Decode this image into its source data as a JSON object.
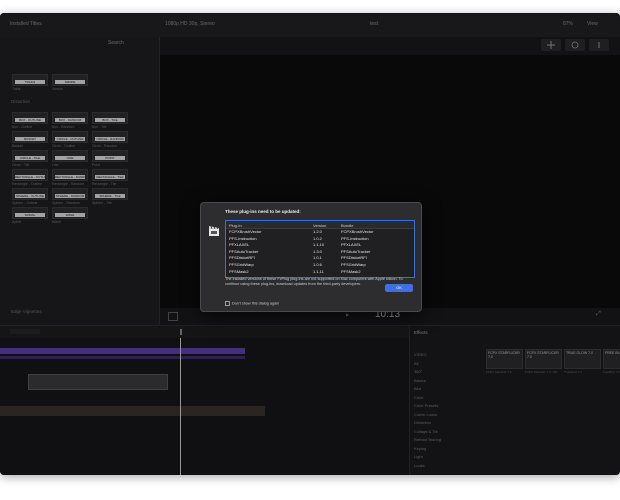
{
  "topbar": {
    "browser_title": "Installed Titles",
    "viewer_title": "1080p HD 30p, Stereo",
    "project": "test",
    "zoom": "87%",
    "view_label": "View"
  },
  "browser": {
    "search_placeholder": "Search",
    "sections": [
      "Distortion",
      "Edge Vignettes"
    ],
    "tiles": [
      {
        "label": "TRAILS",
        "cap": "Trails"
      },
      {
        "label": "SMOKE",
        "cap": "Smoke"
      },
      {
        "label": "BOX - OUTLINE",
        "cap": "Box - Outline"
      },
      {
        "label": "BOX - RANDOM",
        "cap": "Box - Random"
      },
      {
        "label": "BOX - TILE",
        "cap": "Box - Tile"
      },
      {
        "label": "BASKET",
        "cap": "Basket"
      },
      {
        "label": "CIRCLE - OUTLINE",
        "cap": "Circle - Outline"
      },
      {
        "label": "CIRCLE - RANDOM",
        "cap": "Circle - Random"
      },
      {
        "label": "CIRCLE - TILE",
        "cap": "Circle - Tile"
      },
      {
        "label": "LINE",
        "cap": "Line"
      },
      {
        "label": "POINT",
        "cap": "Point"
      },
      {
        "label": "RECTANGLE - OUTLINE",
        "cap": "Rectangle - Outline"
      },
      {
        "label": "RECTANGLE - RANDOM",
        "cap": "Rectangle - Random"
      },
      {
        "label": "RECTANGLE - TILE",
        "cap": "Rectangle - Tile"
      },
      {
        "label": "SPHERE - OUTLINE",
        "cap": "Sphere - Outline"
      },
      {
        "label": "SPHERE - RANDOM",
        "cap": "Sphere - Random"
      },
      {
        "label": "SPHERE - TILE",
        "cap": "Sphere - Tile"
      },
      {
        "label": "SPIRAL",
        "cap": "Spiral"
      },
      {
        "label": "WAVE",
        "cap": "Wave"
      }
    ]
  },
  "viewer": {
    "timecode": "10:13"
  },
  "effects": {
    "title": "Effects",
    "categories": [
      "VIDEO",
      "All",
      "360°",
      "Basics",
      "Blur",
      "Color",
      "Color Presets",
      "Comic Looks",
      "Distortion",
      "Collage & Tilt",
      "Refract Tearing",
      "Keying",
      "Light",
      "Looks"
    ],
    "tiles": [
      "FCPX STARFLICKR 7.0",
      "FCPX STARFLICKR 7.0",
      "TRUE GLOW 7.0",
      "FREE BLUR 7.0"
    ],
    "tile_caps": [
      "FCPX Starflickr 7.0",
      "FCPX Starflickr 7.0 - Mix",
      "TrueGlow 7.0",
      "FreeBlur 7.0"
    ]
  },
  "dialog": {
    "title": "These plug-ins need to be updated:",
    "columns": [
      "Plug-In",
      "Version",
      "Bundle"
    ],
    "rows": [
      {
        "plugin": "FCPXBrushVector",
        "version": "1.2.0",
        "bundle": "FCPXBrushVector"
      },
      {
        "plugin": "PFS-Instruction",
        "version": "1.0.2",
        "bundle": "PFS-Instruction"
      },
      {
        "plugin": "PFXLAXEL",
        "version": "1.1.10",
        "bundle": "PFXLAXEL"
      },
      {
        "plugin": "PFSAutoTracker",
        "version": "1.3.0",
        "bundle": "PFSAutoTracker"
      },
      {
        "plugin": "PFSDistortRFI",
        "version": "1.0.1",
        "bundle": "PFSDistortRFI"
      },
      {
        "plugin": "PFSGridWarp",
        "version": "1.0.6",
        "bundle": "PFSGridWarp"
      },
      {
        "plugin": "PFSMask2",
        "version": "1.1.11",
        "bundle": "PFSMask2"
      }
    ],
    "message": "The installed versions of these FxPlug plug-ins are not supported on Mac computers with Apple silicon. To continue using these plug-ins, download updates from the third-party developers.",
    "checkbox_label": "Don't show this dialog again",
    "ok_label": "OK"
  }
}
